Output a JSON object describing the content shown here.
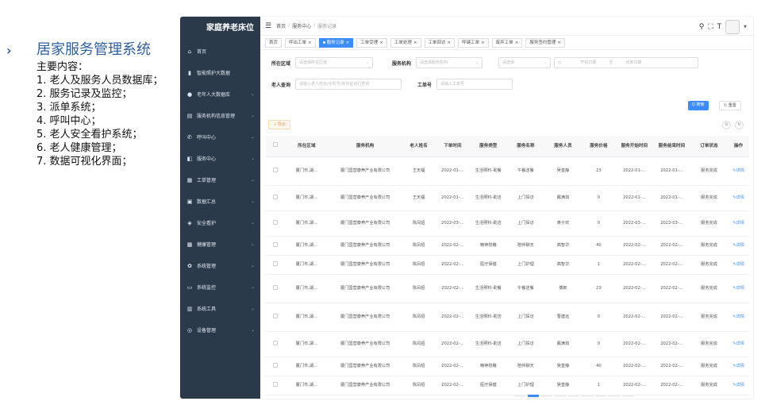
{
  "intro": {
    "arrow": "›",
    "title": "居家服务管理系统",
    "subtitle": "主要内容：",
    "items": [
      "1. 老人及服务人员数据库；",
      "2. 服务记录及监控；",
      "3. 派单系统；",
      "4. 呼叫中心；",
      "5. 老人安全看护系统；",
      "6. 老人健康管理；",
      "7. 数据可视化界面；"
    ]
  },
  "sidebar": {
    "brand": "家庭养老床位",
    "items": [
      {
        "label": "首页",
        "icon": "home-icon",
        "glyph": "⌂",
        "chev": false
      },
      {
        "label": "智能照护大数据",
        "icon": "chart-icon",
        "glyph": "▮",
        "chev": false
      },
      {
        "label": "老年人大数据库",
        "icon": "user-icon",
        "glyph": "●",
        "chev": true
      },
      {
        "label": "服务机构信息管理",
        "icon": "building-icon",
        "glyph": "▤",
        "chev": true
      },
      {
        "label": "呼叫中心",
        "icon": "phone-icon",
        "glyph": "✆",
        "chev": true
      },
      {
        "label": "服务中心",
        "icon": "service-icon",
        "glyph": "◧",
        "chev": true
      },
      {
        "label": "工单管理",
        "icon": "order-icon",
        "glyph": "▦",
        "chev": true
      },
      {
        "label": "数据汇总",
        "icon": "data-icon",
        "glyph": "▣",
        "chev": true
      },
      {
        "label": "安全看护",
        "icon": "shield-icon",
        "glyph": "◈",
        "chev": true
      },
      {
        "label": "健康管理",
        "icon": "health-icon",
        "glyph": "▩",
        "chev": true
      },
      {
        "label": "系统管理",
        "icon": "gear-icon",
        "glyph": "✿",
        "chev": true
      },
      {
        "label": "系统监控",
        "icon": "monitor-icon",
        "glyph": "▭",
        "chev": true
      },
      {
        "label": "系统工具",
        "icon": "tool-icon",
        "glyph": "▥",
        "chev": true
      },
      {
        "label": "设备管理",
        "icon": "device-icon",
        "glyph": "◎",
        "chev": true
      }
    ]
  },
  "topbar": {
    "crumbs": [
      "首页",
      "服务中心",
      "服务记录"
    ],
    "tools": {
      "search": "⚲",
      "fullscreen": "⛶",
      "font": "T"
    }
  },
  "tabs": [
    {
      "label": "首页",
      "active": false,
      "close": false
    },
    {
      "label": "呼出工单",
      "active": false,
      "close": true
    },
    {
      "label": "服务记录",
      "active": true,
      "close": true
    },
    {
      "label": "工单受理",
      "active": false,
      "close": true
    },
    {
      "label": "工单处理",
      "active": false,
      "close": true
    },
    {
      "label": "工单回访",
      "active": false,
      "close": true
    },
    {
      "label": "呼键工单",
      "active": false,
      "close": true
    },
    {
      "label": "废弃工单",
      "active": false,
      "close": true
    },
    {
      "label": "服务签约管理",
      "active": false,
      "close": true
    }
  ],
  "filters": {
    "region_label": "所在区域",
    "region_placeholder": "请选择所在区域",
    "org_label": "服务机构",
    "org_placeholder": "请选择服务机构",
    "select_placeholder": "请选择",
    "start_date": "开始日期",
    "to": "至",
    "end_date": "结束日期",
    "elder_label": "老人查询",
    "elder_placeholder": "请输入老人姓名/手机号/身份证进行查询",
    "order_label": "工单号",
    "order_placeholder": "请输入工单号"
  },
  "buttons": {
    "search": "Q 搜索",
    "reset": "↻ 重置",
    "export": "⇣ 导出",
    "refresh": "↻",
    "columns": "⊙"
  },
  "table": {
    "headers": [
      "所在区域",
      "服务机构",
      "老人姓名",
      "下单时间",
      "服务类型",
      "服务名称",
      "服务人员",
      "服务价格",
      "服务开始时间",
      "服务结束时间",
      "订单状态",
      "操作"
    ],
    "rows": [
      [
        "厦门市,湖...",
        "厦门国营康养产业有限公司",
        "王天福",
        "2022-01-...",
        "生活照料-助餐",
        "午餐送餐",
        "吴皇静",
        "23",
        "2022-01-...",
        "2022-01-...",
        "服务完成",
        "✎详情"
      ],
      [
        "厦门市,湖...",
        "厦门国营康养产业有限公司",
        "王天福",
        "2022-01-...",
        "生活照料-助洁",
        "上门探访",
        "戴满如",
        "0",
        "2022-01-...",
        "2022-01-...",
        "服务完成",
        "✎详情"
      ],
      [
        "厦门市,湖...",
        "厦门国营康养产业有限公司",
        "陈凤招",
        "2022-03-...",
        "生活照料-助洁",
        "上门探访",
        "黄子欢",
        "0",
        "2022-03-...",
        "2022-03-...",
        "服务完成",
        "✎详情"
      ],
      [
        "厦门市,湖...",
        "厦门国营康养产业有限公司",
        "陈凤招",
        "2022-02-...",
        "精神慰藉",
        "陪伴聊天",
        "高智华",
        "40",
        "2022-02-...",
        "2022-02-...",
        "服务完成",
        "✎详情"
      ],
      [
        "厦门市,湖...",
        "厦门国营康养产业有限公司",
        "陈凤招",
        "2022-02-...",
        "医疗保健",
        "上门护理",
        "高智华",
        "1",
        "2022-02-...",
        "2022-02-...",
        "服务完成",
        "✎详情"
      ],
      [
        "厦门市,湖...",
        "厦门国营康养产业有限公司",
        "陈凤招",
        "2022-02-...",
        "生活照料-助餐",
        "午餐送餐",
        "傅郎",
        "23",
        "2022-02-...",
        "2022-02-...",
        "服务完成",
        "✎详情"
      ],
      [
        "厦门市,湖...",
        "厦门国营康养产业有限公司",
        "陈凤招",
        "2022-02-...",
        "生活照料-助洁",
        "上门探访",
        "曹建远",
        "0",
        "2022-02-...",
        "2022-02-...",
        "服务完成",
        "✎详情"
      ],
      [
        "厦门市,湖...",
        "厦门国营康养产业有限公司",
        "陈凤招",
        "2022-02-...",
        "生活照料-助洁",
        "上门探访",
        "戴满如",
        "0",
        "2022-02-...",
        "2022-02-...",
        "服务完成",
        "✎详情"
      ],
      [
        "厦门市,湖...",
        "厦门国营康养产业有限公司",
        "陈凤招",
        "2022-02-...",
        "精神慰藉",
        "陪伴聊天",
        "吴皇静",
        "40",
        "2022-02-...",
        "2022-02-...",
        "服务完成",
        "✎详情"
      ],
      [
        "厦门市,湖...",
        "厦门国营康养产业有限公司",
        "陈凤招",
        "2022-02-...",
        "医疗保健",
        "上门护理",
        "吴皇静",
        "1",
        "2022-02-...",
        "2022-02-...",
        "服务完成",
        "✎详情"
      ]
    ]
  },
  "colors": {
    "accent": "#3b8cff",
    "sidebar": "#2b3a4b",
    "title": "#2e5fa0"
  }
}
